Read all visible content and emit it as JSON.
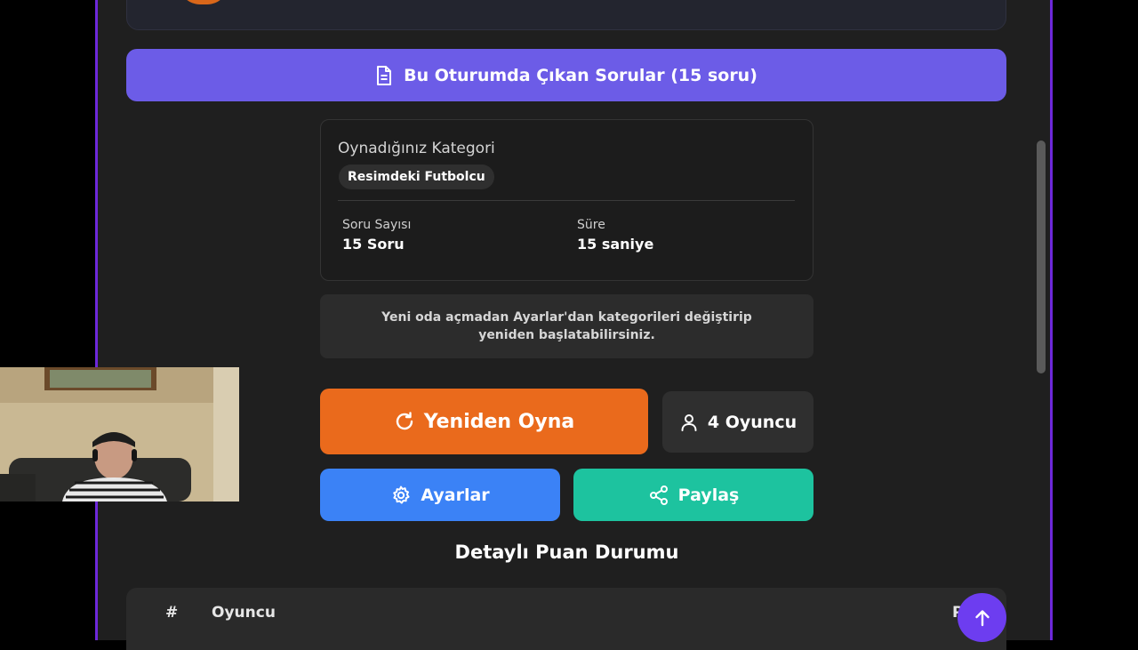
{
  "questions_button": {
    "label": "Bu Oturumda Çıkan Sorular (15 soru)",
    "icon": "document-icon"
  },
  "category_card": {
    "title": "Oynadığınız Kategori",
    "chip": "Resimdeki Futbolcu",
    "stats": [
      {
        "label": "Soru Sayısı",
        "value": "15 Soru"
      },
      {
        "label": "Süre",
        "value": "15 saniye"
      }
    ]
  },
  "info_text": "Yeni oda açmadan Ayarlar'dan kategorileri değiştirip yeniden başlatabilirsiniz.",
  "buttons": {
    "replay": {
      "label": "Yeniden Oyna",
      "icon": "refresh-icon"
    },
    "players": {
      "label": "4 Oyuncu",
      "icon": "user-icon"
    },
    "settings": {
      "label": "Ayarlar",
      "icon": "gear-icon"
    },
    "share": {
      "label": "Paylaş",
      "icon": "share-icon"
    }
  },
  "scoreboard": {
    "title": "Detaylı Puan Durumu",
    "columns": [
      "#",
      "Oyuncu",
      "P"
    ]
  },
  "scroll_top_button": {
    "icon": "arrow-up-icon"
  },
  "colors": {
    "accent_purple": "#6c5ce7",
    "replay_orange": "#ea6a1c",
    "settings_blue": "#3b82f6",
    "share_teal": "#1dc39f",
    "frame_border": "#6d28d9"
  }
}
